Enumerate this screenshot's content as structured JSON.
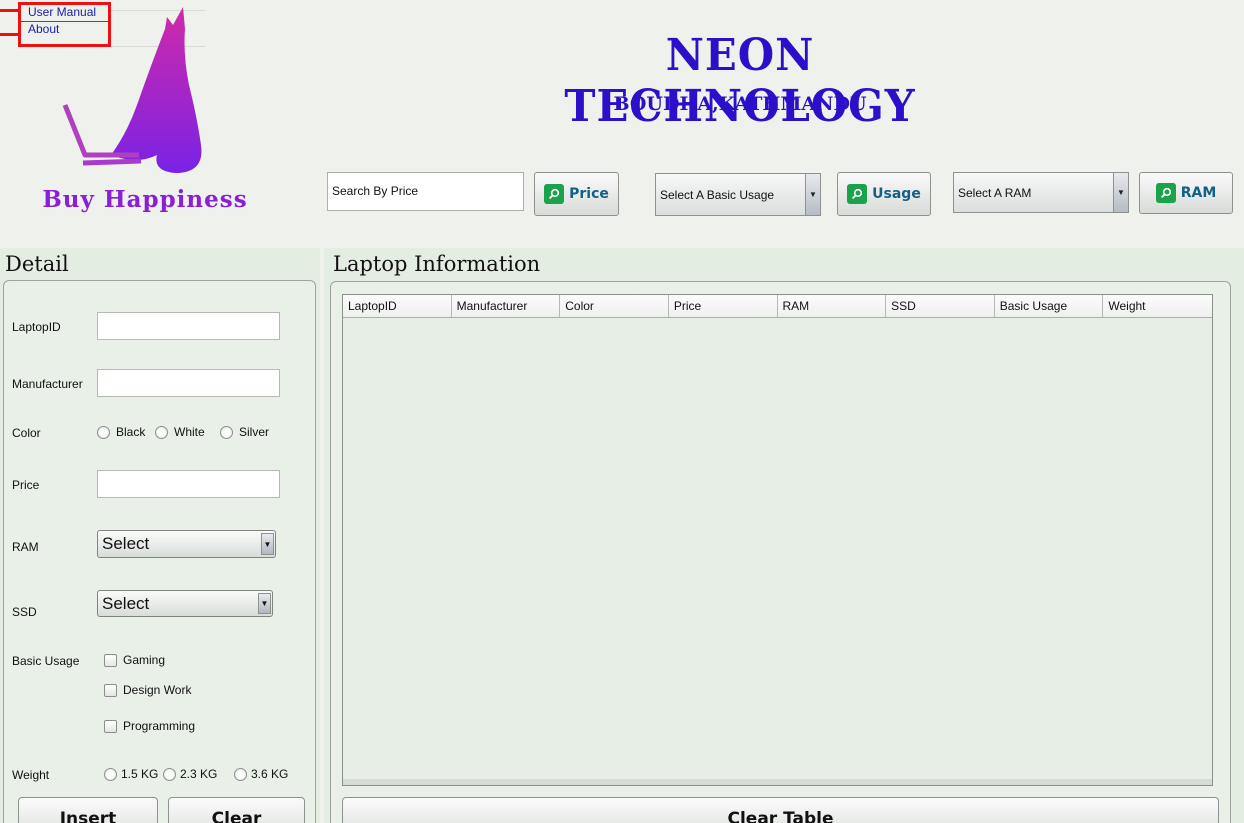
{
  "menu": {
    "items": [
      {
        "label": "User Manual"
      },
      {
        "label": "About"
      }
    ]
  },
  "header": {
    "title": "NEON TECHNOLOGY",
    "subtitle": "BOUDHA,KATHMANDU",
    "brand": "Buy Happiness"
  },
  "search": {
    "price_value": "Search By Price",
    "price_button": "Price",
    "usage_select": "Select A Basic Usage",
    "usage_button": "Usage",
    "ram_select": "Select A RAM",
    "ram_button": "RAM"
  },
  "detail": {
    "title": "Detail",
    "laptop_id_label": "LaptopID",
    "manufacturer_label": "Manufacturer",
    "color_label": "Color",
    "color_options": [
      "Black",
      "White",
      "Silver"
    ],
    "price_label": "Price",
    "ram_label": "RAM",
    "ram_select": "Select",
    "ssd_label": "SSD",
    "ssd_select": "Select",
    "usage_label": "Basic Usage",
    "usage_options": [
      "Gaming",
      "Design Work",
      "Programming"
    ],
    "weight_label": "Weight",
    "weight_options": [
      "1.5 KG",
      "2.3 KG",
      "3.6 KG"
    ],
    "insert_button": "Insert",
    "clear_button": "Clear"
  },
  "info": {
    "title": "Laptop Information",
    "columns": [
      "LaptopID",
      "Manufacturer",
      "Color",
      "Price",
      "RAM",
      "SSD",
      "Basic Usage",
      "Weight"
    ],
    "clear_table_button": "Clear Table"
  },
  "colors": {
    "accent": "#2a10c8",
    "brand": "#8a1fd8",
    "search_icon": "#1aa34a",
    "menu_border": "#ee1111"
  },
  "icons": {
    "search": "search-icon",
    "logo": "kangaroo-laptop-logo"
  }
}
